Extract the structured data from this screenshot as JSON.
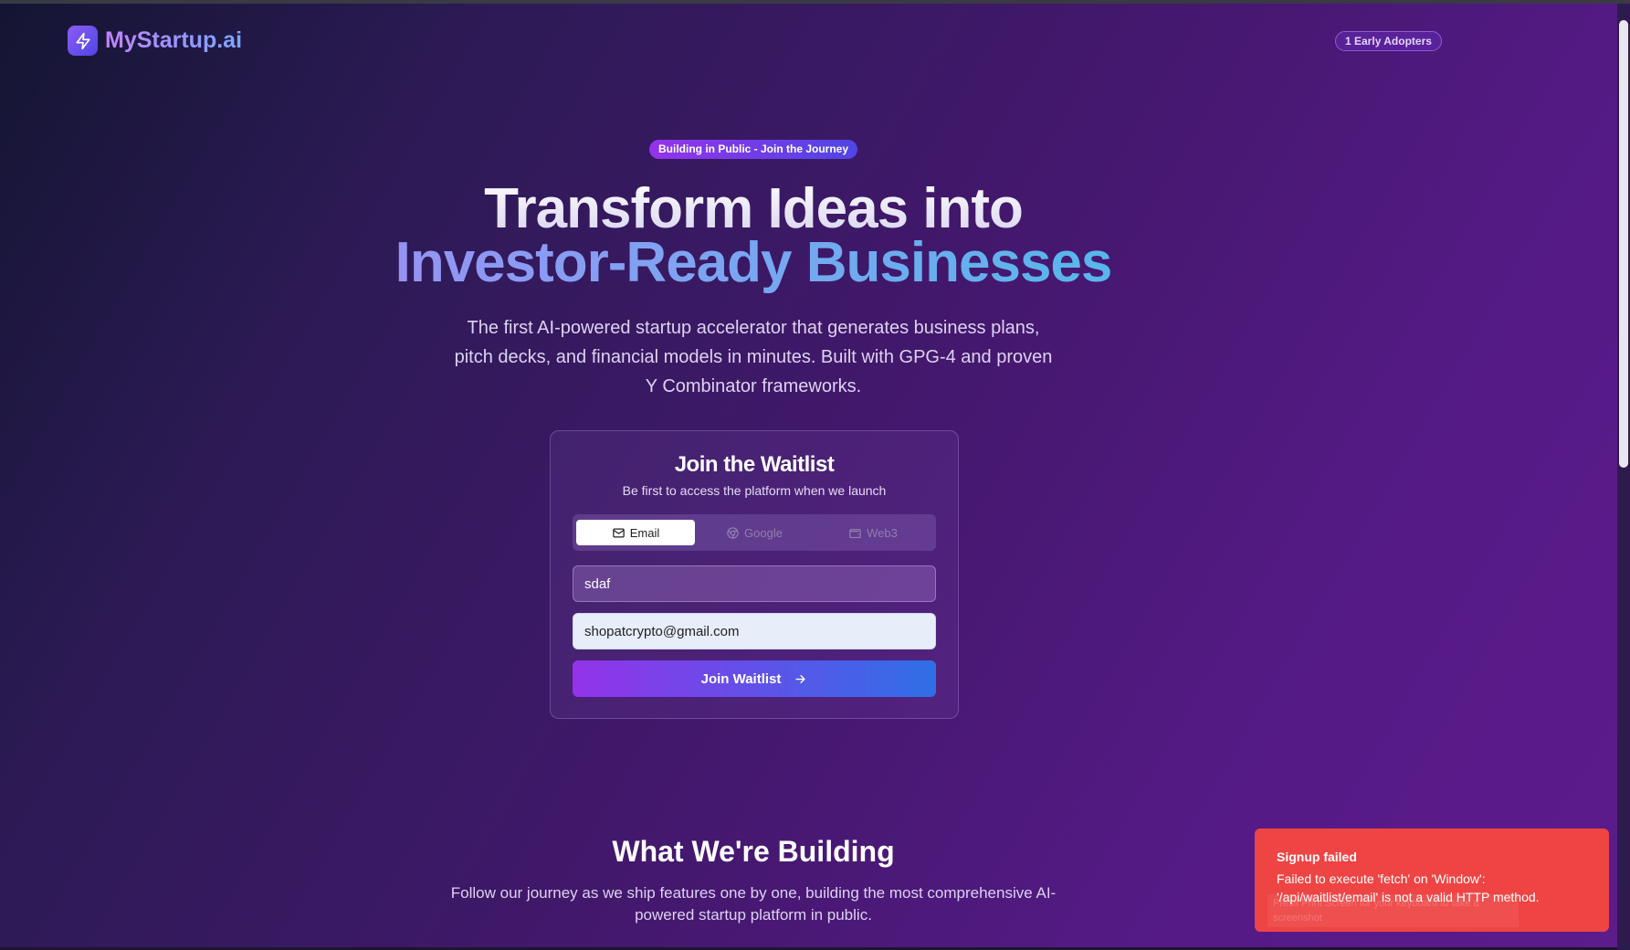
{
  "header": {
    "brand_name": "MyStartup.ai",
    "adopters_badge": "1 Early Adopters"
  },
  "hero": {
    "pill": "Building in Public - Join the Journey",
    "title_line1": "Transform Ideas into",
    "title_word1": "Investor-Ready",
    "title_word2": "Businesses",
    "subtitle": "The first AI-powered startup accelerator that generates business plans, pitch decks, and financial models in minutes. Built with GPG-4 and proven Y Combinator frameworks."
  },
  "waitlist": {
    "title": "Join the Waitlist",
    "subtitle": "Be first to access the platform when we launch",
    "tabs": [
      {
        "label": "Email",
        "icon": "mail-icon",
        "active": true
      },
      {
        "label": "Google",
        "icon": "chrome-icon",
        "active": false
      },
      {
        "label": "Web3",
        "icon": "wallet-icon",
        "active": false
      }
    ],
    "name_value": "sdaf",
    "email_value": "shopatcrypto@gmail.com",
    "submit_label": "Join Waitlist"
  },
  "section": {
    "title": "What We're Building",
    "subtitle": "Follow our journey as we ship features one by one, building the most comprehensive AI-powered startup platform in public."
  },
  "toast": {
    "title": "Signup failed",
    "message": "Failed to execute 'fetch' on 'Window': '/api/waitlist/email' is not a valid HTTP method.",
    "ghost_text": "Press Print Screen for your keyboard to take a screenshot"
  },
  "colors": {
    "toast_bg": "#ef4444",
    "accent_purple": "#9333ea",
    "accent_blue": "#2f6fe6"
  }
}
